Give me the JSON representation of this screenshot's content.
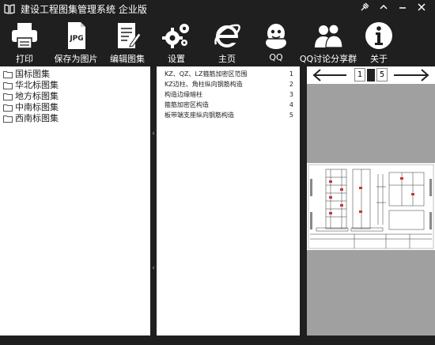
{
  "window": {
    "title": "建设工程图集管理系统  企业版",
    "controls": {
      "pin": "pin-icon",
      "collapse": "chevron-up-icon",
      "minimize": "minimize-icon",
      "close": "close-icon"
    }
  },
  "toolbar": {
    "print": "打印",
    "save_image": "保存为图片",
    "jpg_badge": "JPG",
    "edit": "编辑图集",
    "settings": "设置",
    "home": "主页",
    "qq": "QQ",
    "qq_group": "QQ讨论分享群",
    "about": "关于"
  },
  "tree": {
    "items": [
      "国标图集",
      "华北标图集",
      "地方标图集",
      "中南标图集",
      "西南标图集"
    ]
  },
  "list": {
    "rows": [
      {
        "title": "KZ、QZ、LZ箍筋加密区范围",
        "num": "1"
      },
      {
        "title": "KZ边柱、角柱纵向钢筋构造",
        "num": "2"
      },
      {
        "title": "构造边缘暗柱",
        "num": "3"
      },
      {
        "title": "箍筋加密区构造",
        "num": "4"
      },
      {
        "title": "板带端支座纵向钢筋构造",
        "num": "5"
      }
    ]
  },
  "pager": {
    "current": "1",
    "total": "5",
    "prev_icon": "arrow-left-icon",
    "next_icon": "arrow-right-icon"
  }
}
